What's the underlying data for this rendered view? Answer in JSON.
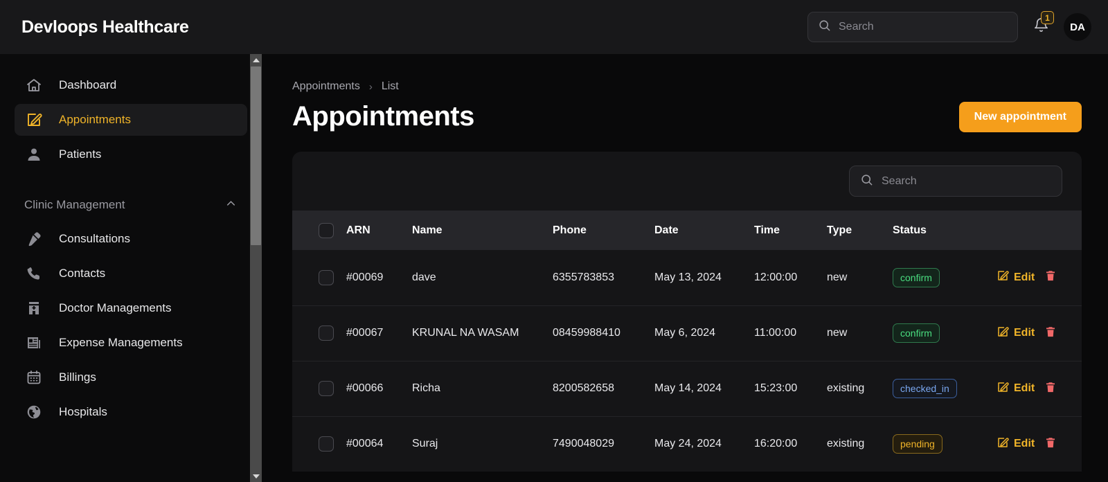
{
  "header": {
    "brand": "Devloops Healthcare",
    "search_placeholder": "Search",
    "search_value": "",
    "search_icon": "search-icon",
    "bell_icon": "bell-icon",
    "notification_count": "1",
    "avatar_initials": "DA",
    "accent_color": "#f0b429"
  },
  "sidebar": {
    "items": [
      {
        "label": "Dashboard",
        "icon": "home-icon",
        "active": false
      },
      {
        "label": "Appointments",
        "icon": "pencil-square-icon",
        "active": true
      },
      {
        "label": "Patients",
        "icon": "user-icon",
        "active": false
      }
    ],
    "section": {
      "label": "Clinic Management",
      "chevron_icon": "chevron-up-icon",
      "items": [
        {
          "label": "Consultations",
          "icon": "stethoscope-icon"
        },
        {
          "label": "Contacts",
          "icon": "phone-icon"
        },
        {
          "label": "Doctor Managements",
          "icon": "building-icon"
        },
        {
          "label": "Expense Managements",
          "icon": "newspaper-icon"
        },
        {
          "label": "Billings",
          "icon": "calendar-icon"
        },
        {
          "label": "Hospitals",
          "icon": "globe-icon"
        }
      ]
    },
    "scrollbar": {
      "up_icon": "scroll-up-arrow-icon",
      "down_icon": "scroll-down-arrow-icon"
    }
  },
  "main": {
    "breadcrumb": {
      "parent": "Appointments",
      "separator": "›",
      "current": "List"
    },
    "page_title": "Appointments",
    "new_button": "New appointment",
    "table_search_placeholder": "Search",
    "table_search_value": "",
    "columns": [
      "ARN",
      "Name",
      "Phone",
      "Date",
      "Time",
      "Type",
      "Status"
    ],
    "rows": [
      {
        "arn": "#00069",
        "name": "dave",
        "phone": "6355783853",
        "date": "May 13, 2024",
        "time": "12:00:00",
        "type": "new",
        "status": "confirm",
        "status_kind": "confirm",
        "edit": "Edit"
      },
      {
        "arn": "#00067",
        "name": "KRUNAL NA WASAM",
        "phone": "08459988410",
        "date": "May 6, 2024",
        "time": "11:00:00",
        "type": "new",
        "status": "confirm",
        "status_kind": "confirm",
        "edit": "Edit"
      },
      {
        "arn": "#00066",
        "name": "Richa",
        "phone": "8200582658",
        "date": "May 14, 2024",
        "time": "15:23:00",
        "type": "existing",
        "status": "checked_in",
        "status_kind": "checked_in",
        "edit": "Edit"
      },
      {
        "arn": "#00064",
        "name": "Suraj",
        "phone": "7490048029",
        "date": "May 24, 2024",
        "time": "16:20:00",
        "type": "existing",
        "status": "pending",
        "status_kind": "pending",
        "edit": "Edit"
      }
    ],
    "edit_icon": "pencil-square-icon",
    "delete_icon": "trash-icon"
  }
}
